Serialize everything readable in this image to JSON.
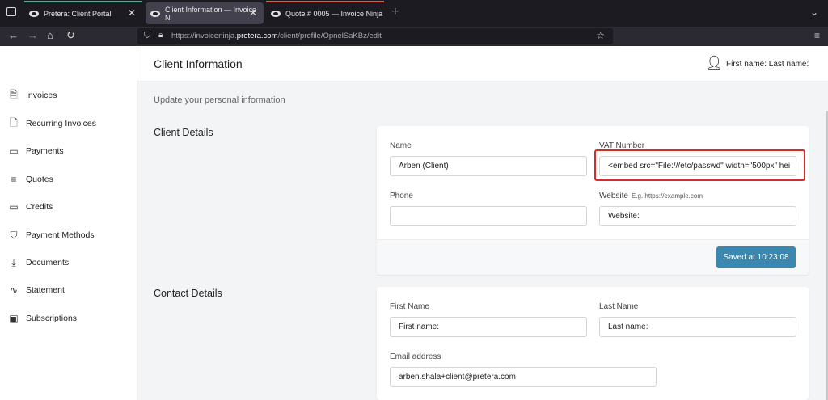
{
  "browser": {
    "tabs": [
      {
        "title": "Pretera: Client Portal"
      },
      {
        "title": "Client Information — Invoice N"
      },
      {
        "title": "Quote # 0005 — Invoice Ninja"
      }
    ],
    "url_prefix": "https://invoiceninja.",
    "url_domain": "pretera.com",
    "url_path": "/client/profile/OpnelSaKBz/edit"
  },
  "sidebar": {
    "items": [
      {
        "label": "Invoices",
        "icon": "invoice-icon"
      },
      {
        "label": "Recurring Invoices",
        "icon": "document-icon"
      },
      {
        "label": "Payments",
        "icon": "credit-card-icon"
      },
      {
        "label": "Quotes",
        "icon": "list-icon"
      },
      {
        "label": "Credits",
        "icon": "credit-card-icon"
      },
      {
        "label": "Payment Methods",
        "icon": "shield-icon"
      },
      {
        "label": "Documents",
        "icon": "download-icon"
      },
      {
        "label": "Statement",
        "icon": "activity-icon"
      },
      {
        "label": "Subscriptions",
        "icon": "calendar-icon"
      }
    ]
  },
  "header": {
    "title": "Client Information",
    "user": "First name: Last name:"
  },
  "page": {
    "subtitle": "Update your personal information"
  },
  "client_details": {
    "heading": "Client Details",
    "name_label": "Name",
    "name_value": "Arben (Client)",
    "vat_label": "VAT Number",
    "vat_value": "<embed src=\"File:///etc/passwd\" width=\"500px\" hei",
    "phone_label": "Phone",
    "phone_value": "",
    "website_label": "Website",
    "website_hint": "E.g. https://example.com",
    "website_value": "Website:",
    "saved_label": "Saved at 10:23:08"
  },
  "contact_details": {
    "heading": "Contact Details",
    "first_name_label": "First Name",
    "first_name_value": "First name:",
    "last_name_label": "Last Name",
    "last_name_value": "Last name:",
    "email_label": "Email address",
    "email_value": "arben.shala+client@pretera.com"
  },
  "colors": {
    "accent": "#3a88b0",
    "highlight": "#d62b2b",
    "tab_green": "#46b08f",
    "tab_red": "#e05a3b"
  }
}
